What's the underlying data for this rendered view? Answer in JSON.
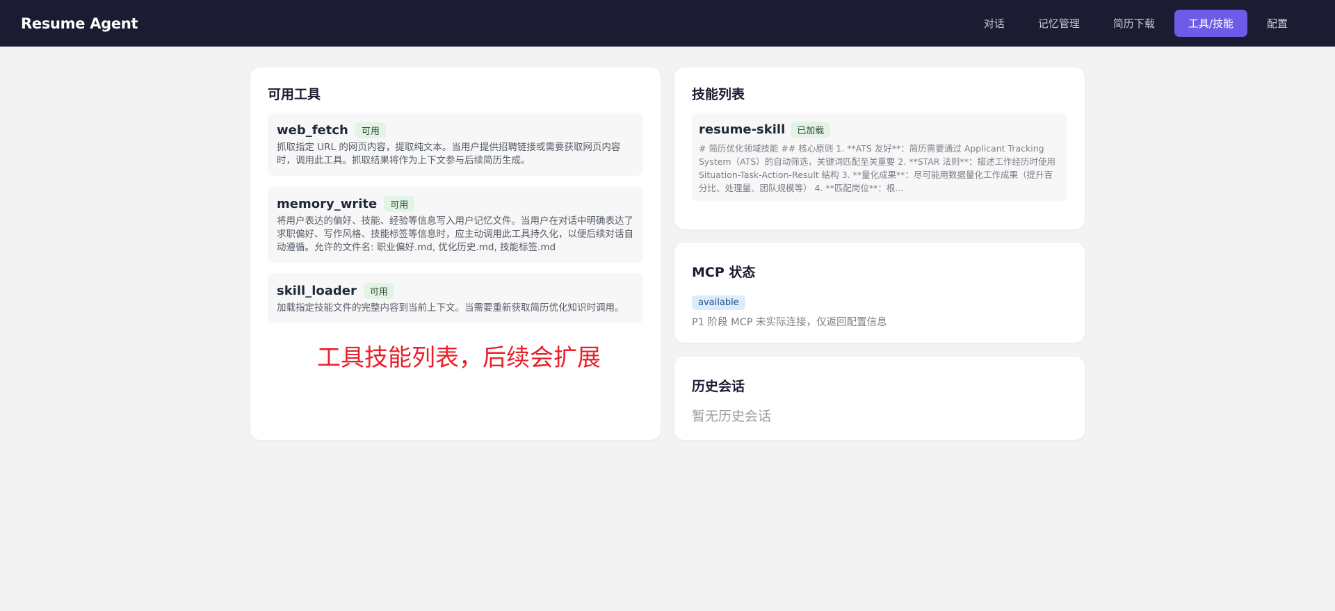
{
  "header": {
    "brand": "Resume Agent",
    "nav": [
      {
        "label": "对话"
      },
      {
        "label": "记忆管理"
      },
      {
        "label": "简历下载"
      },
      {
        "label": "工具/技能",
        "active": true
      },
      {
        "label": "配置"
      }
    ],
    "accent_color": "#6c5ce7"
  },
  "tools": {
    "title": "可用工具",
    "items": [
      {
        "name": "web_fetch",
        "badge": "可用",
        "desc": "抓取指定 URL 的网页内容，提取纯文本。当用户提供招聘链接或需要获取网页内容时，调用此工具。抓取结果将作为上下文参与后续简历生成。"
      },
      {
        "name": "memory_write",
        "badge": "可用",
        "desc": "将用户表达的偏好、技能、经验等信息写入用户记忆文件。当用户在对话中明确表达了求职偏好、写作风格、技能标签等信息时，应主动调用此工具持久化，以便后续对话自动遵循。允许的文件名: 职业偏好.md, 优化历史.md, 技能标签.md"
      },
      {
        "name": "skill_loader",
        "badge": "可用",
        "desc": "加载指定技能文件的完整内容到当前上下文。当需要重新获取简历优化知识时调用。"
      }
    ],
    "note": "工具技能列表，后续会扩展"
  },
  "skills": {
    "title": "技能列表",
    "items": [
      {
        "name": "resume-skill",
        "badge": "已加载",
        "desc": "# 简历优化领域技能 ## 核心原则 1. **ATS 友好**：简历需要通过 Applicant Tracking System（ATS）的自动筛选，关键词匹配至关重要 2. **STAR 法则**：描述工作经历时使用 Situation-Task-Action-Result 结构 3. **量化成果**：尽可能用数据量化工作成果（提升百分比、处理量、团队规模等） 4. **匹配岗位**：根..."
      }
    ]
  },
  "mcp": {
    "title": "MCP 状态",
    "status": "available",
    "info": "P1 阶段 MCP 未实际连接，仅返回配置信息"
  },
  "history": {
    "title": "历史会话",
    "empty": "暂无历史会话"
  }
}
